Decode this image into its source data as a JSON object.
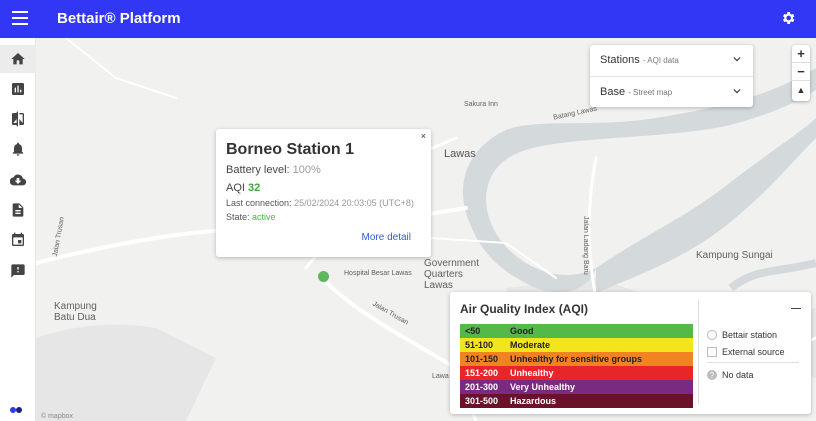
{
  "header": {
    "title": "Bettair® Platform",
    "menu_icon": "menu-icon",
    "settings_icon": "gear-icon",
    "bar_color": "#3137f5"
  },
  "sidenav": {
    "items": [
      "home-icon",
      "chart-icon",
      "compare-icon",
      "bell-icon",
      "cloud-download-icon",
      "document-icon",
      "calendar-icon",
      "feedback-icon"
    ]
  },
  "map": {
    "labels": {
      "lawas": "Lawas",
      "sakura_inn": "Sakura Inn",
      "batang_lawas": "Batang Lawas",
      "jalan_trusan_1": "Jalan Trusan",
      "jalan_trusan_2": "Jalan Trusan",
      "jalan_ladang_baru": "Jalan Ladang Baru",
      "government_quarters": "Government Quarters Lawas",
      "hospital": "Hospital Besar Lawas",
      "kampung_sungai": "Kampung Sungai",
      "kampung_batu_dua": "Kampung Batu Dua",
      "lawa": "Lawa",
      "attribution": "© mapbox"
    }
  },
  "popup": {
    "station_name": "Borneo Station 1",
    "close_symbol": "×",
    "battery_label": "Battery level:",
    "battery_value": "100%",
    "aqi_label": "AQI",
    "aqi_value": "32",
    "last_connection_label": "Last connection:",
    "last_connection_value": "25/02/2024 20:03:05 (UTC+8)",
    "state_label": "State:",
    "state_value": "active",
    "more_detail": "More detail"
  },
  "layers": {
    "stations": {
      "label": "Stations",
      "sub": "- AQI data"
    },
    "base": {
      "label": "Base",
      "sub": "- Street map"
    }
  },
  "zoom": {
    "in": "+",
    "out": "−",
    "reset": "▲"
  },
  "legend": {
    "title": "Air Quality Index (AQI)",
    "bands": [
      {
        "range": "<50",
        "label": "Good",
        "color": "#54b948",
        "text_color": "#222222"
      },
      {
        "range": "51-100",
        "label": "Moderate",
        "color": "#f2e51e",
        "text_color": "#222222"
      },
      {
        "range": "101-150",
        "label": "Unhealthy for sensitive groups",
        "color": "#f28322",
        "text_color": "#222222"
      },
      {
        "range": "151-200",
        "label": "Unhealthy",
        "color": "#e8262a",
        "text_color": "#ffffff"
      },
      {
        "range": "201-300",
        "label": "Very Unhealthy",
        "color": "#7b2a82",
        "text_color": "#ffffff"
      },
      {
        "range": "301-500",
        "label": "Hazardous",
        "color": "#6b1228",
        "text_color": "#ffffff"
      }
    ],
    "keys": {
      "bettair_station": "Bettair station",
      "external_source": "External source",
      "no_data": "No data"
    }
  }
}
